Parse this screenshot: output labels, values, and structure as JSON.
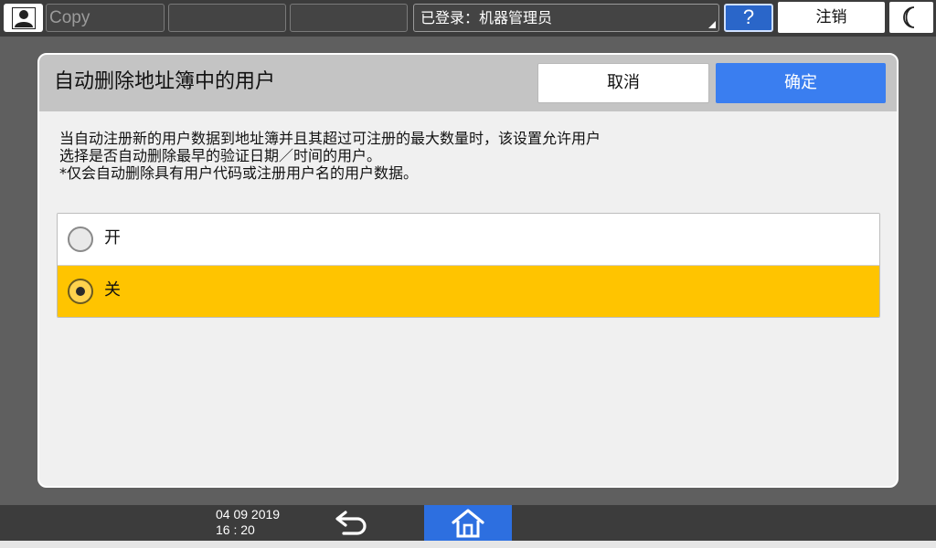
{
  "topbar": {
    "user_icon": "user-icon",
    "slot1_label": "Copy",
    "login_status": "已登录：机器管理员",
    "help_label": "?",
    "logout_label": "注销",
    "sleep_icon": "moon-icon"
  },
  "dialog": {
    "title": "自动删除地址簿中的用户",
    "cancel_label": "取消",
    "ok_label": "确定",
    "description": [
      "当自动注册新的用户数据到地址簿并且其超过可注册的最大数量时，该设置允许用户",
      "选择是否自动删除最早的验证日期／时间的用户。",
      "*仅会自动删除具有用户代码或注册用户名的用户数据。"
    ],
    "options": [
      {
        "label": "开",
        "selected": false
      },
      {
        "label": "关",
        "selected": true
      }
    ],
    "selected_color": "#ffc400",
    "accent_color": "#3a7ef0"
  },
  "bottombar": {
    "date": "04 09 2019",
    "time": "16 : 20",
    "back_icon": "back-arrow-icon",
    "home_icon": "home-icon"
  }
}
